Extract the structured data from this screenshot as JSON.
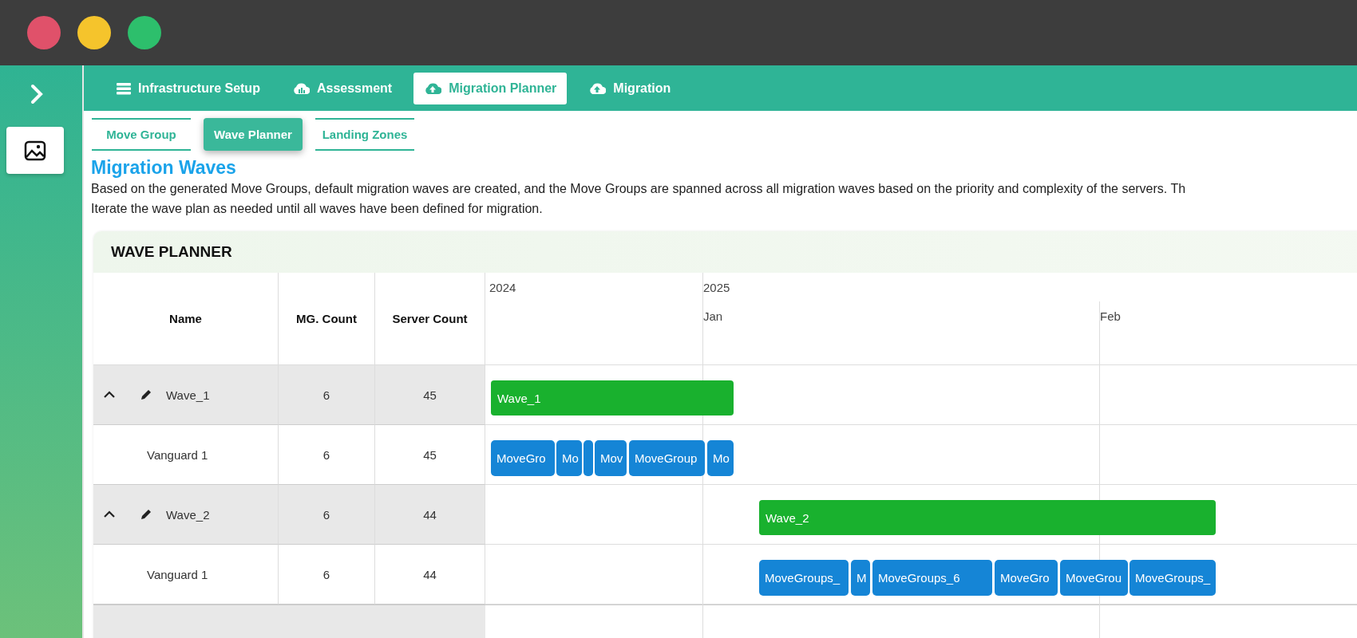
{
  "window_controls": [
    {
      "color": "#e0516a"
    },
    {
      "color": "#f5c42c"
    },
    {
      "color": "#2dbf6c"
    }
  ],
  "tabs": [
    {
      "label": "Infrastructure Setup",
      "selected": false
    },
    {
      "label": "Assessment",
      "selected": false
    },
    {
      "label": "Migration Planner",
      "selected": true
    },
    {
      "label": "Migration",
      "selected": false
    }
  ],
  "subtabs": [
    {
      "label": "Move Group",
      "selected": false
    },
    {
      "label": "Wave Planner",
      "selected": true
    },
    {
      "label": "Landing Zones",
      "selected": false
    }
  ],
  "title": "Migration Waves",
  "description": [
    "Based on the generated Move Groups, default migration waves are created, and the Move Groups are spanned across all migration waves based on the priority and complexity of the servers. Th",
    "Iterate the wave plan as needed until all waves have been defined for migration."
  ],
  "planner": {
    "title": "WAVE PLANNER",
    "columns": [
      "Name",
      "MG. Count",
      "Server Count"
    ],
    "years": [
      "2024",
      "2025"
    ],
    "months": [
      "Jan",
      "Feb"
    ],
    "rows": [
      {
        "kind": "wave",
        "name": "Wave_1",
        "expanded": true,
        "mg_count": "6",
        "server_count": "45",
        "bar_label": "Wave_1"
      },
      {
        "kind": "group",
        "name": "Vanguard 1",
        "mg_count": "6",
        "server_count": "45",
        "segments": [
          "MoveGro",
          "Mo",
          "Mov",
          "MoveGroup",
          "Mo"
        ]
      },
      {
        "kind": "wave",
        "name": "Wave_2",
        "expanded": true,
        "mg_count": "6",
        "server_count": "44",
        "bar_label": "Wave_2"
      },
      {
        "kind": "group",
        "name": "Vanguard 1",
        "mg_count": "6",
        "server_count": "44",
        "segments": [
          "MoveGroups_",
          "M",
          "MoveGroups_6",
          "MoveGro",
          "MoveGrou",
          "MoveGroups_"
        ]
      }
    ]
  }
}
